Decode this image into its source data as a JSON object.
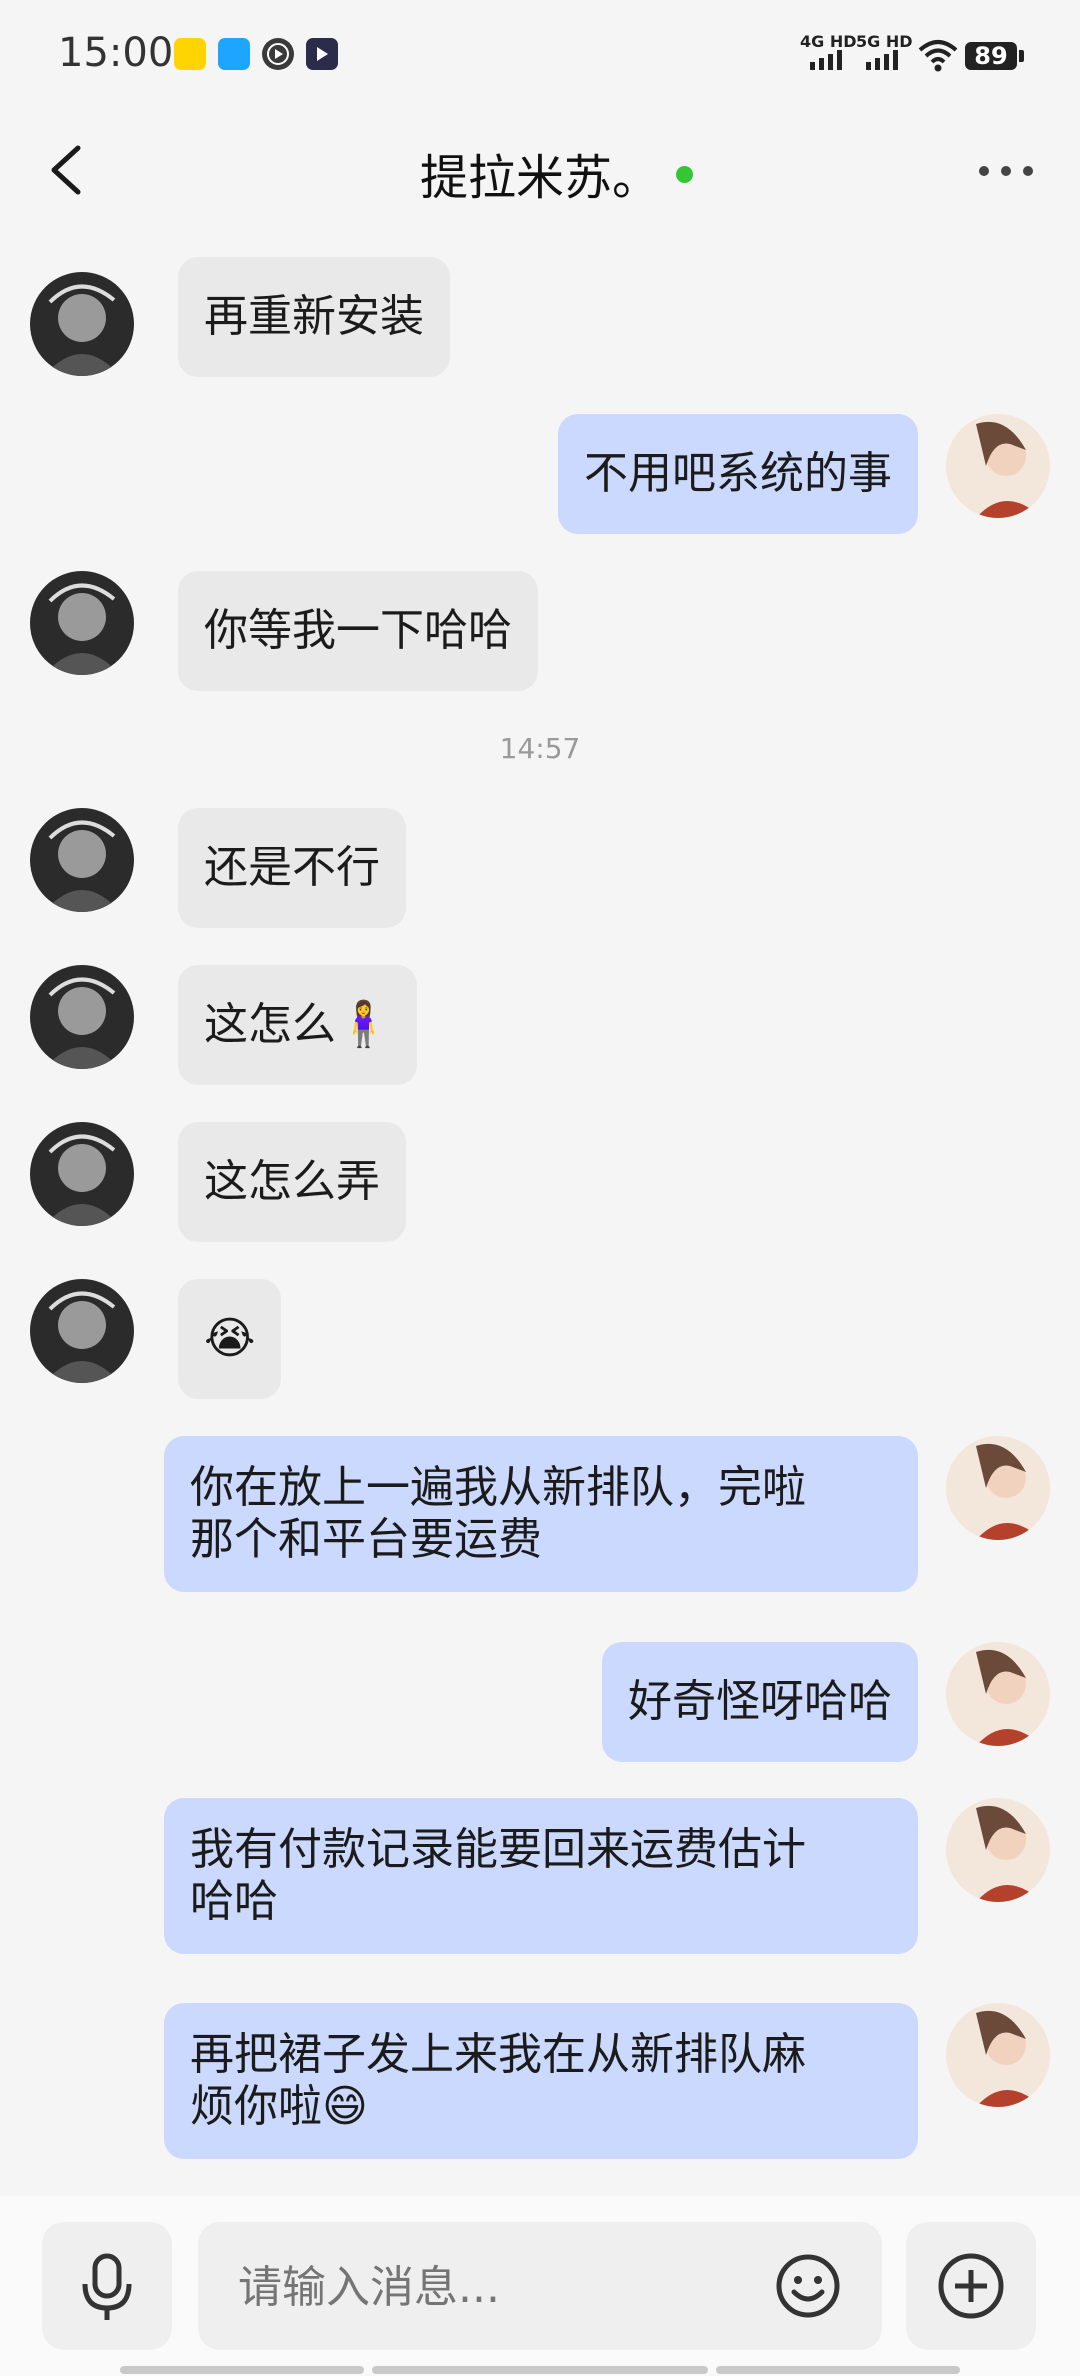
{
  "status_bar": {
    "time": "15:00",
    "net1": "4G HD",
    "net2": "5G HD",
    "battery": "89",
    "app_icons": [
      "yellow-app-icon",
      "blue-app-icon",
      "play-app-icon",
      "video-app-icon"
    ]
  },
  "header": {
    "title": "提拉米苏。",
    "online_color": "#35c635"
  },
  "messages": [
    {
      "side": "in",
      "text": "再重新安装"
    },
    {
      "side": "out",
      "text": "不用吧系统的事"
    },
    {
      "side": "in",
      "text": "你等我一下哈哈"
    },
    {
      "timestamp": "14:57"
    },
    {
      "side": "in",
      "text": "还是不行"
    },
    {
      "side": "in",
      "text": "这怎么🧍‍♀️"
    },
    {
      "side": "in",
      "text": "这怎么弄"
    },
    {
      "side": "in",
      "text": "😭"
    },
    {
      "side": "out",
      "text": "你在放上一遍我从新排队，完啦\n那个和平台要运费"
    },
    {
      "side": "out",
      "text": "好奇怪呀哈哈"
    },
    {
      "side": "out",
      "text": "我有付款记录能要回来运费估计\n哈哈"
    },
    {
      "side": "out",
      "text": "再把裙子发上来我在从新排队麻\n烦你啦😄"
    }
  ],
  "input": {
    "placeholder": "请输入消息..."
  },
  "colors": {
    "incoming_bubble": "#e9e9e9",
    "outgoing_bubble": "#cad9fd"
  }
}
